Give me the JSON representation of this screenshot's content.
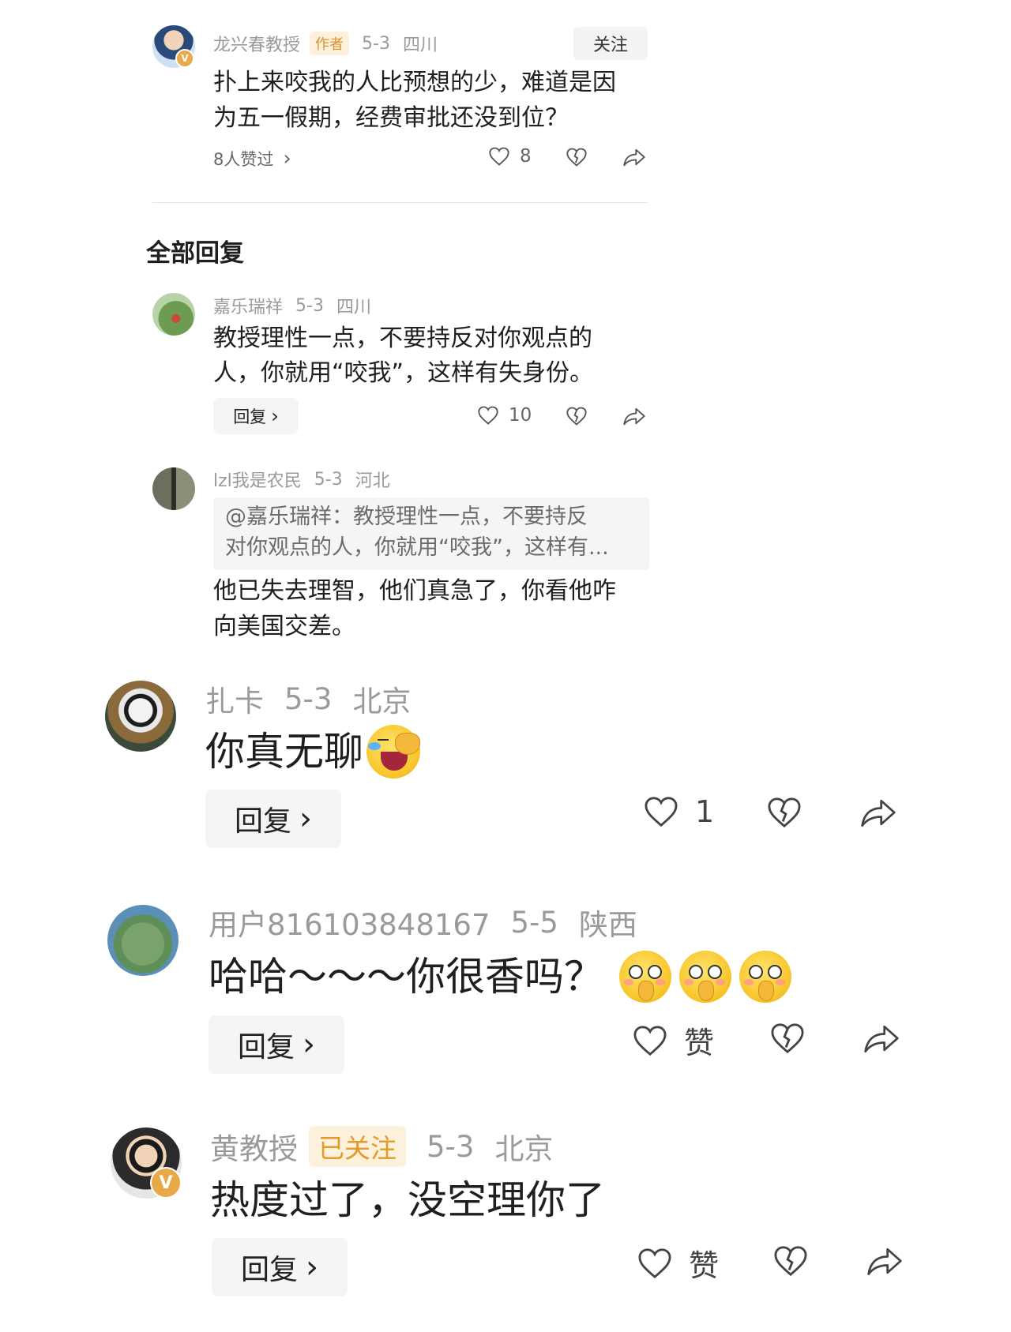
{
  "author_comment": {
    "name": "龙兴春教授",
    "tag": "作者",
    "date": "5-3",
    "location": "四川",
    "follow_label": "关注",
    "text_line1": "扑上来咬我的人比预想的少，难道是因",
    "text_line2": "为五一假期，经费审批还没到位？",
    "liked_by": "8人赞过",
    "like_count": "8"
  },
  "section_title": "全部回复",
  "replies": [
    {
      "name": "嘉乐瑞祥",
      "date": "5-3",
      "location": "四川",
      "text_line1": "教授理性一点，不要持反对你观点的",
      "text_line2": "人，你就用“咬我”，这样有失身份。",
      "reply_label": "回复",
      "like_count": "10"
    },
    {
      "name": "lzl我是农民",
      "date": "5-3",
      "location": "河北",
      "quote_line1": "@嘉乐瑞祥：教授理性一点，不要持反",
      "quote_line2": "对你观点的人，你就用“咬我”，这样有...",
      "text_line1": "他已失去理智，他们真急了，你看他咋",
      "text_line2": "向美国交差。"
    },
    {
      "name": "扎卡",
      "date": "5-3",
      "location": "北京",
      "text": "你真无聊",
      "reply_label": "回复",
      "like_count": "1"
    },
    {
      "name": "用户816103848167",
      "date": "5-5",
      "location": "陕西",
      "text": "哈哈～～～你很香吗？",
      "reply_label": "回复",
      "like_label": "赞"
    },
    {
      "name": "黄教授",
      "tag": "已关注",
      "date": "5-3",
      "location": "北京",
      "text": "热度过了，没空理你了",
      "reply_label": "回复",
      "like_label": "赞"
    }
  ],
  "icons": {
    "verified_badge": "V",
    "chevron": "›",
    "like": "heart-outline-icon",
    "dislike": "broken-heart-icon",
    "share": "share-arrow-icon"
  },
  "colors": {
    "meta_gray": "#9a9a9a",
    "author_tag": "#d9922e",
    "badge": "#e8a948"
  }
}
